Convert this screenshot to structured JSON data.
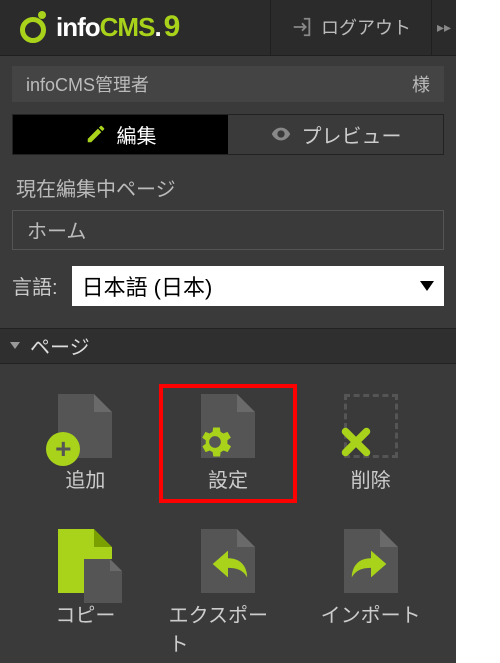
{
  "header": {
    "logout_label": "ログアウト"
  },
  "user": {
    "name": "infoCMS管理者",
    "suffix": "様"
  },
  "tabs": {
    "edit_label": "編集",
    "preview_label": "プレビュー"
  },
  "page_section": {
    "current_label": "現在編集中ページ",
    "page_name": "ホーム"
  },
  "language": {
    "label": "言語:",
    "selected": "日本語 (日本)"
  },
  "group": {
    "title": "ページ"
  },
  "actions": {
    "add": "追加",
    "settings": "設定",
    "delete": "削除",
    "copy": "コピー",
    "export": "エクスポート",
    "import": "インポート"
  },
  "colors": {
    "accent": "#a9d31a",
    "highlight": "#ff0000"
  }
}
